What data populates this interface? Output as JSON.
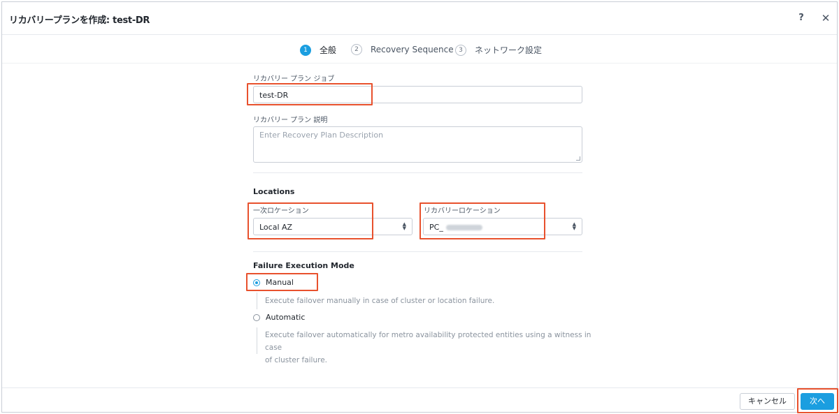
{
  "dialog": {
    "title": "リカバリープランを作成: test-DR",
    "help_icon": "?",
    "close_icon": "✕"
  },
  "steps": [
    {
      "number": "1",
      "label": "全般",
      "active": true
    },
    {
      "number": "2",
      "label": "Recovery Sequence",
      "active": false
    },
    {
      "number": "3",
      "label": "ネットワーク設定",
      "active": false
    }
  ],
  "form": {
    "job_label": "リカバリー プラン ジョブ",
    "job_value": "test-DR",
    "desc_label": "リカバリー プラン 説明",
    "desc_placeholder": "Enter Recovery Plan Description",
    "locations_title": "Locations",
    "primary_label": "一次ロケーション",
    "primary_value": "Local AZ",
    "recovery_label": "リカバリーロケーション",
    "recovery_value": "PC_",
    "failure_title": "Failure Execution Mode",
    "manual_label": "Manual",
    "manual_desc": "Execute failover manually in case of cluster or location failure.",
    "auto_label": "Automatic",
    "auto_desc_line1": "Execute failover automatically for metro availability protected entities using a witness in case",
    "auto_desc_line2": "of cluster failure.",
    "selected_mode": "Manual"
  },
  "footer": {
    "cancel_label": "キャンセル",
    "next_label": "次へ"
  },
  "colors": {
    "accent": "#1b9ee0",
    "highlight": "#e8512d"
  },
  "icons": {
    "select_caret": "chevron-up-down-icon"
  }
}
